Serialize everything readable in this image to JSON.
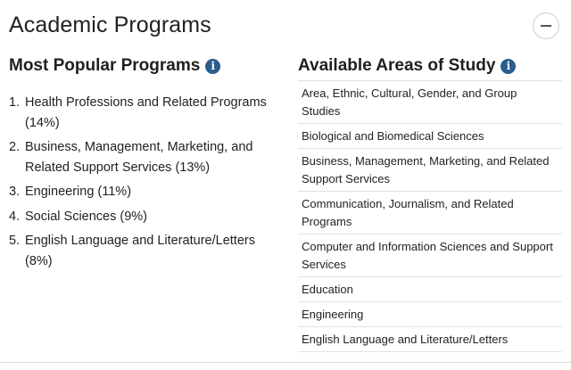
{
  "section": {
    "title": "Academic Programs",
    "collapse_icon": "minus-icon"
  },
  "popular": {
    "heading": "Most Popular Programs",
    "info_icon": "i",
    "items": [
      {
        "num": "1.",
        "text": "Health Professions and Related Programs (14%)"
      },
      {
        "num": "2.",
        "text": "Business, Management, Marketing, and Related Support Services (13%)"
      },
      {
        "num": "3.",
        "text": "Engineering (11%)"
      },
      {
        "num": "4.",
        "text": "Social Sciences (9%)"
      },
      {
        "num": "5.",
        "text": "English Language and Literature/Letters (8%)"
      }
    ]
  },
  "areas": {
    "heading": "Available Areas of Study",
    "info_icon": "i",
    "items": [
      "Area, Ethnic, Cultural, Gender, and Group Studies",
      "Biological and Biomedical Sciences",
      "Business, Management, Marketing, and Related Support Services",
      "Communication, Journalism, and Related Programs",
      "Computer and Information Sciences and Support Services",
      "Education",
      "Engineering",
      "English Language and Literature/Letters"
    ]
  },
  "colors": {
    "info_icon_bg": "#2b5d8c",
    "divider": "#e2e2e2",
    "text": "#222222"
  }
}
